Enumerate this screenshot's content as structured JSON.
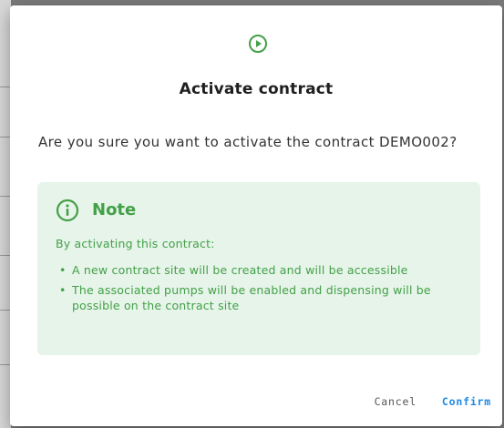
{
  "dialog": {
    "icon": "play-circle-icon",
    "title": "Activate contract",
    "message": "Are you sure you want to activate the contract DEMO002?",
    "note": {
      "icon": "info-circle-icon",
      "title": "Note",
      "intro": "By activating this contract:",
      "items": [
        "A new contract site will be created and will be accessible",
        "The associated pumps will be enabled and dispensing will be possible on the contract site"
      ]
    },
    "actions": {
      "cancel_label": "Cancel",
      "confirm_label": "Confirm"
    }
  },
  "colors": {
    "accent_green": "#43a047",
    "note_background": "#e6f4ea",
    "confirm_blue": "#1e88e5"
  }
}
